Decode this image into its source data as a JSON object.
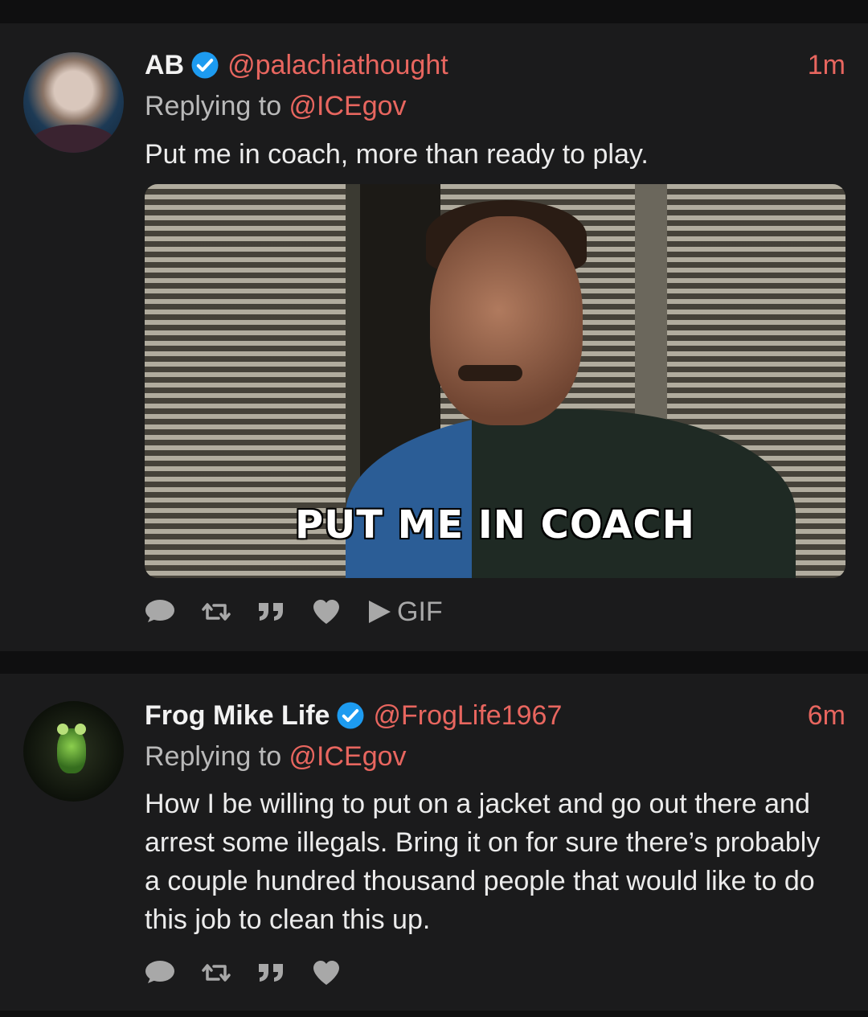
{
  "tweets": [
    {
      "name": "AB",
      "handle": "@palachiathought",
      "time": "1m",
      "replying_prefix": "Replying to ",
      "replying_to": "@ICEgov",
      "text": "Put me in coach, more than ready to play.",
      "media": {
        "caption": "PUT ME IN COACH",
        "badge": "GIF"
      }
    },
    {
      "name": "Frog Mike Life",
      "handle": "@FrogLife1967",
      "time": "6m",
      "replying_prefix": "Replying to ",
      "replying_to": "@ICEgov",
      "text": "How I be willing to put on a jacket and go out there and arrest some illegals. Bring it on for sure there’s probably a couple hundred thousand people that would like to do this job to clean this up."
    }
  ],
  "icons": [
    "comment-icon",
    "retweet-icon",
    "quote-icon",
    "like-icon",
    "play-icon",
    "verified-icon"
  ],
  "colors": {
    "accent": "#e8665f",
    "verified": "#1d9bf0",
    "background": "#1b1b1c"
  }
}
